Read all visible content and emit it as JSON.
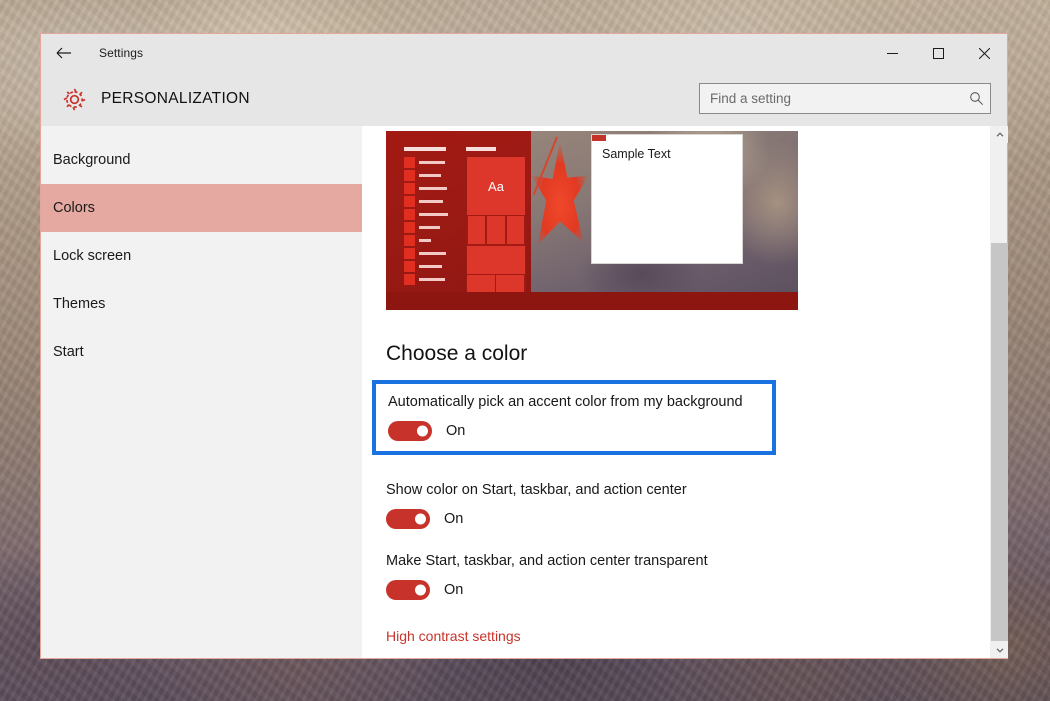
{
  "window": {
    "titlebar_title": "Settings",
    "back_icon": "back-arrow-icon",
    "minimize_icon": "minimize-icon",
    "maximize_icon": "maximize-icon",
    "close_icon": "close-icon"
  },
  "header": {
    "gear_icon": "gear-icon",
    "app_title": "PERSONALIZATION",
    "accent_color": "#c7332a"
  },
  "search": {
    "placeholder": "Find a setting",
    "value": "",
    "icon": "search-icon"
  },
  "sidebar": {
    "items": [
      {
        "label": "Background",
        "selected": false
      },
      {
        "label": "Colors",
        "selected": true
      },
      {
        "label": "Lock screen",
        "selected": false
      },
      {
        "label": "Themes",
        "selected": false
      },
      {
        "label": "Start",
        "selected": false
      }
    ],
    "selected_bg": "#e5a9a2"
  },
  "preview": {
    "tile_label": "Aa",
    "sample_window_title": "Sample Text",
    "accent_color": "#a31913"
  },
  "main": {
    "section_title": "Choose a color",
    "highlight_border_color": "#1a72e0",
    "settings": [
      {
        "label": "Automatically pick an accent color from my background",
        "state": "On",
        "highlighted": true
      },
      {
        "label": "Show color on Start, taskbar, and action center",
        "state": "On",
        "highlighted": false
      },
      {
        "label": "Make Start, taskbar, and action center transparent",
        "state": "On",
        "highlighted": false
      }
    ],
    "link_label": "High contrast settings",
    "link_color": "#c7332a"
  },
  "scrollbar": {
    "up_icon": "chevron-up-icon",
    "down_icon": "chevron-down-icon"
  }
}
